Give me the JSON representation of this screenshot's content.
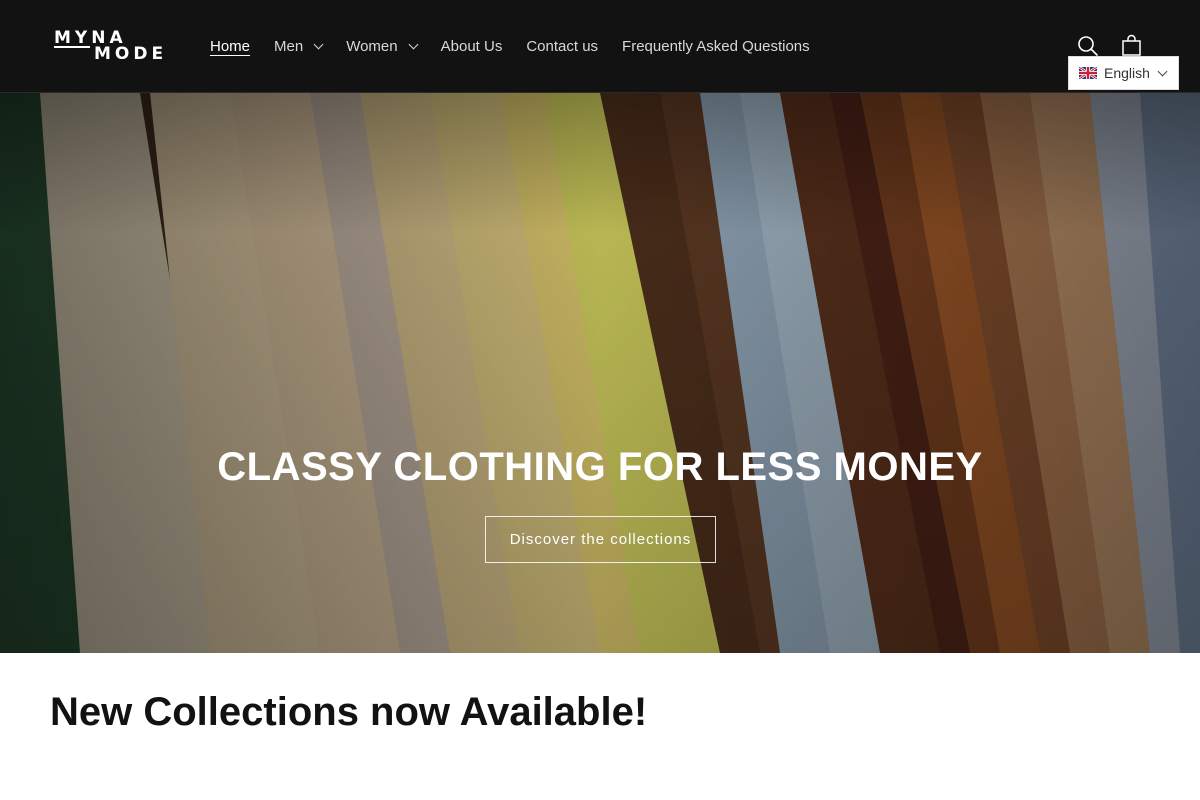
{
  "brand": {
    "logo_line1": "MYNA",
    "logo_line2": "MODE"
  },
  "nav": {
    "items": [
      {
        "label": "Home",
        "active": true,
        "has_dropdown": false
      },
      {
        "label": "Men",
        "active": false,
        "has_dropdown": true
      },
      {
        "label": "Women",
        "active": false,
        "has_dropdown": true
      },
      {
        "label": "About Us",
        "active": false,
        "has_dropdown": false
      },
      {
        "label": "Contact us",
        "active": false,
        "has_dropdown": false
      },
      {
        "label": "Frequently Asked Questions",
        "active": false,
        "has_dropdown": false
      }
    ]
  },
  "header_icons": {
    "search": "search-icon",
    "cart": "cart-icon"
  },
  "language": {
    "selected": "English",
    "flag": "uk-flag-icon"
  },
  "hero": {
    "title": "CLASSY CLOTHING FOR LESS MONEY",
    "button_label": "Discover the collections"
  },
  "section": {
    "title": "New Collections now Available!"
  },
  "colors": {
    "header_bg": "#121212",
    "text_dark": "#121212",
    "white": "#ffffff"
  }
}
